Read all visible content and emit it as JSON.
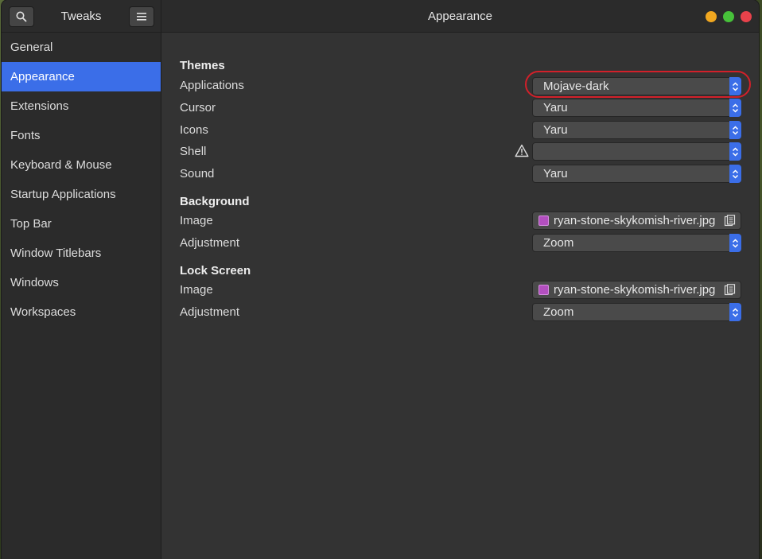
{
  "window": {
    "app_title": "Tweaks",
    "page_title": "Appearance"
  },
  "sidebar": {
    "items": [
      {
        "label": "General"
      },
      {
        "label": "Appearance"
      },
      {
        "label": "Extensions"
      },
      {
        "label": "Fonts"
      },
      {
        "label": "Keyboard & Mouse"
      },
      {
        "label": "Startup Applications"
      },
      {
        "label": "Top Bar"
      },
      {
        "label": "Window Titlebars"
      },
      {
        "label": "Windows"
      },
      {
        "label": "Workspaces"
      }
    ],
    "active_index": 1
  },
  "themes": {
    "title": "Themes",
    "applications_label": "Applications",
    "applications_value": "Mojave-dark",
    "cursor_label": "Cursor",
    "cursor_value": "Yaru",
    "icons_label": "Icons",
    "icons_value": "Yaru",
    "shell_label": "Shell",
    "shell_value": "",
    "sound_label": "Sound",
    "sound_value": "Yaru"
  },
  "background": {
    "title": "Background",
    "image_label": "Image",
    "image_value": "ryan-stone-skykomish-river.jpg",
    "adjustment_label": "Adjustment",
    "adjustment_value": "Zoom"
  },
  "lock_screen": {
    "title": "Lock Screen",
    "image_label": "Image",
    "image_value": "ryan-stone-skykomish-river.jpg",
    "adjustment_label": "Adjustment",
    "adjustment_value": "Zoom"
  },
  "colors": {
    "accent": "#3b6ee8",
    "highlight_ring": "#d2202a",
    "minimize": "#f0a720",
    "maximize": "#47c13a",
    "close": "#e8424b"
  }
}
